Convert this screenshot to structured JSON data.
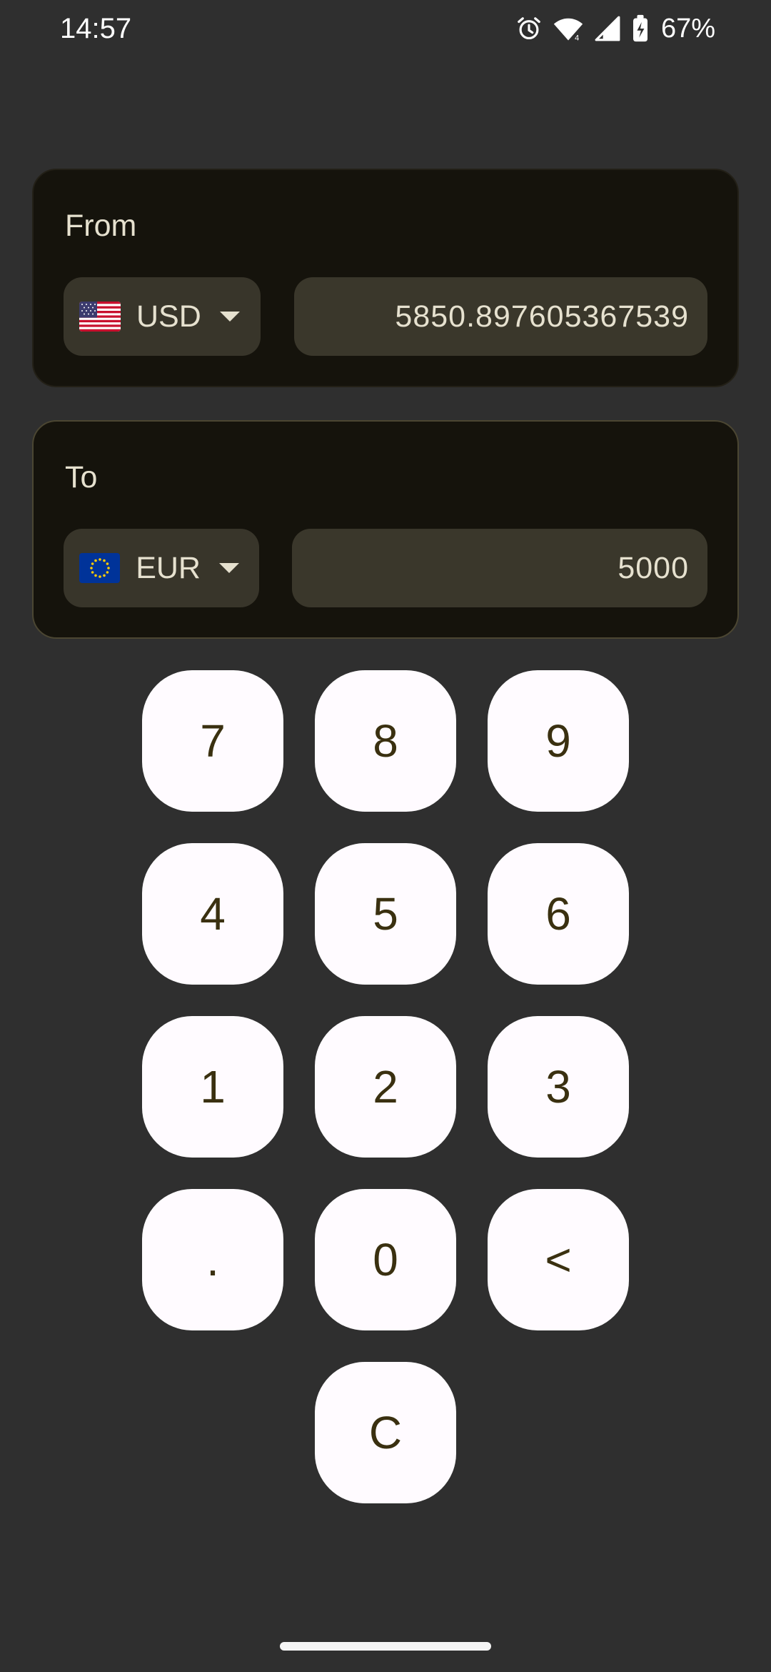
{
  "status_bar": {
    "time": "14:57",
    "battery_percent": "67%",
    "icons": [
      "alarm-icon",
      "wifi-icon",
      "signal-icon",
      "battery-charging-icon"
    ]
  },
  "from_card": {
    "label": "From",
    "currency_code": "USD",
    "flag": "us-flag-icon",
    "amount": "5850.897605367539"
  },
  "to_card": {
    "label": "To",
    "currency_code": "EUR",
    "flag": "eu-flag-icon",
    "amount": "5000"
  },
  "keypad": {
    "k7": "7",
    "k8": "8",
    "k9": "9",
    "k4": "4",
    "k5": "5",
    "k6": "6",
    "k1": "1",
    "k2": "2",
    "k3": "3",
    "kdot": ".",
    "k0": "0",
    "kback": "<",
    "kclear": "C"
  },
  "colors": {
    "background": "#2f2f2f",
    "card": "#15130c",
    "field": "#3a372b",
    "key": "#fffbff",
    "key_text": "#3a3010"
  }
}
